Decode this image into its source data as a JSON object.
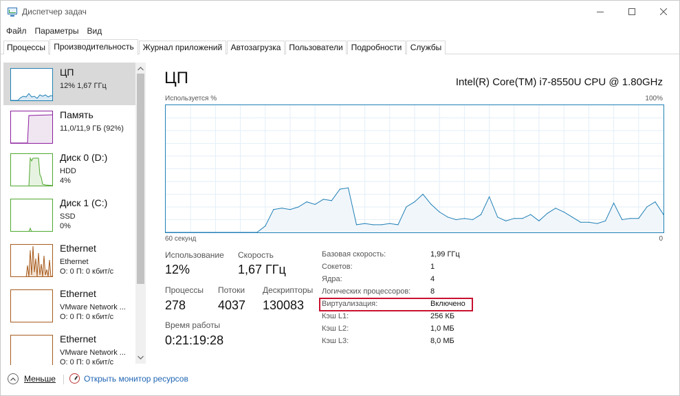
{
  "window": {
    "title": "Диспетчер задач",
    "controls": {
      "minimize": "minimize-icon",
      "maximize": "maximize-icon",
      "close": "close-icon"
    }
  },
  "menu": [
    "Файл",
    "Параметры",
    "Вид"
  ],
  "tabs": [
    {
      "label": "Процессы",
      "active": false
    },
    {
      "label": "Производительность",
      "active": true
    },
    {
      "label": "Журнал приложений",
      "active": false
    },
    {
      "label": "Автозагрузка",
      "active": false
    },
    {
      "label": "Пользователи",
      "active": false
    },
    {
      "label": "Подробности",
      "active": false
    },
    {
      "label": "Службы",
      "active": false
    }
  ],
  "sidebar": {
    "items": [
      {
        "title": "ЦП",
        "line1": "12%  1,67 ГГц",
        "line2": "",
        "color": "#1f7fb5",
        "selected": true
      },
      {
        "title": "Память",
        "line1": "11,0/11,9 ГБ (92%)",
        "line2": "",
        "color": "#8b1c9e",
        "selected": false
      },
      {
        "title": "Диск 0 (D:)",
        "line1": "HDD",
        "line2": "4%",
        "color": "#4da72e",
        "selected": false
      },
      {
        "title": "Диск 1 (C:)",
        "line1": "SSD",
        "line2": "0%",
        "color": "#4da72e",
        "selected": false
      },
      {
        "title": "Ethernet",
        "line1": "Ethernet",
        "line2": "О: 0 П: 0 кбит/с",
        "color": "#a75a1c",
        "selected": false
      },
      {
        "title": "Ethernet",
        "line1": "VMware Network ...",
        "line2": "О: 0 П: 0 кбит/с",
        "color": "#a75a1c",
        "selected": false
      },
      {
        "title": "Ethernet",
        "line1": "VMware Network ...",
        "line2": "О: 0 П: 0 кбит/с",
        "color": "#a75a1c",
        "selected": false
      }
    ]
  },
  "main": {
    "heading": "ЦП",
    "cpu_model": "Intel(R) Core(TM) i7-8550U CPU @ 1.80GHz",
    "graph": {
      "label_top_left": "Используется %",
      "label_top_right": "100%",
      "label_bottom_left": "60 секунд",
      "label_bottom_right": "0",
      "accent": "#1f7fb5"
    },
    "stats": {
      "usage_label": "Использование",
      "usage_value": "12%",
      "speed_label": "Скорость",
      "speed_value": "1,67 ГГц",
      "processes_label": "Процессы",
      "processes_value": "278",
      "threads_label": "Потоки",
      "threads_value": "4037",
      "handles_label": "Дескрипторы",
      "handles_value": "130083",
      "uptime_label": "Время работы",
      "uptime_value": "0:21:19:28"
    },
    "properties": [
      {
        "label": "Базовая скорость:",
        "value": "1,99 ГГц"
      },
      {
        "label": "Сокетов:",
        "value": "1"
      },
      {
        "label": "Ядра:",
        "value": "4"
      },
      {
        "label": "Логических процессоров:",
        "value": "8"
      },
      {
        "label": "Виртуализация:",
        "value": "Включено",
        "highlight_color": "#c8102e"
      },
      {
        "label": "Кэш L1:",
        "value": "256 КБ"
      },
      {
        "label": "Кэш L2:",
        "value": "1,0 МБ"
      },
      {
        "label": "Кэш L3:",
        "value": "8,0 МБ"
      }
    ]
  },
  "footer": {
    "less_label": "Меньше",
    "resource_monitor_label": "Открыть монитор ресурсов"
  },
  "chart_data": {
    "type": "area",
    "xlabel": "60 секунд",
    "ylabel": "Используется %",
    "ylim": [
      0,
      100
    ],
    "xlim": [
      60,
      0
    ],
    "grid": true,
    "x": [
      60,
      49,
      48,
      47,
      46,
      45,
      44,
      43,
      42,
      41,
      40,
      39,
      38,
      37,
      36,
      35,
      34,
      33,
      32,
      31,
      30,
      29,
      28,
      27,
      26,
      25,
      24,
      23,
      22,
      21,
      20,
      19,
      18,
      17,
      16,
      15,
      14,
      13,
      12,
      11,
      10,
      9,
      8,
      7,
      6,
      5,
      4,
      3,
      2,
      1,
      0
    ],
    "values": [
      0,
      0,
      5,
      18,
      19,
      18,
      20,
      24,
      22,
      26,
      25,
      34,
      35,
      6,
      7,
      6,
      6,
      7,
      6,
      20,
      24,
      30,
      22,
      16,
      12,
      10,
      11,
      10,
      14,
      28,
      12,
      9,
      11,
      11,
      14,
      9,
      15,
      19,
      16,
      12,
      8,
      8,
      7,
      9,
      23,
      10,
      11,
      11,
      20,
      24,
      14
    ],
    "series": [
      {
        "name": "ЦП"
      }
    ]
  }
}
